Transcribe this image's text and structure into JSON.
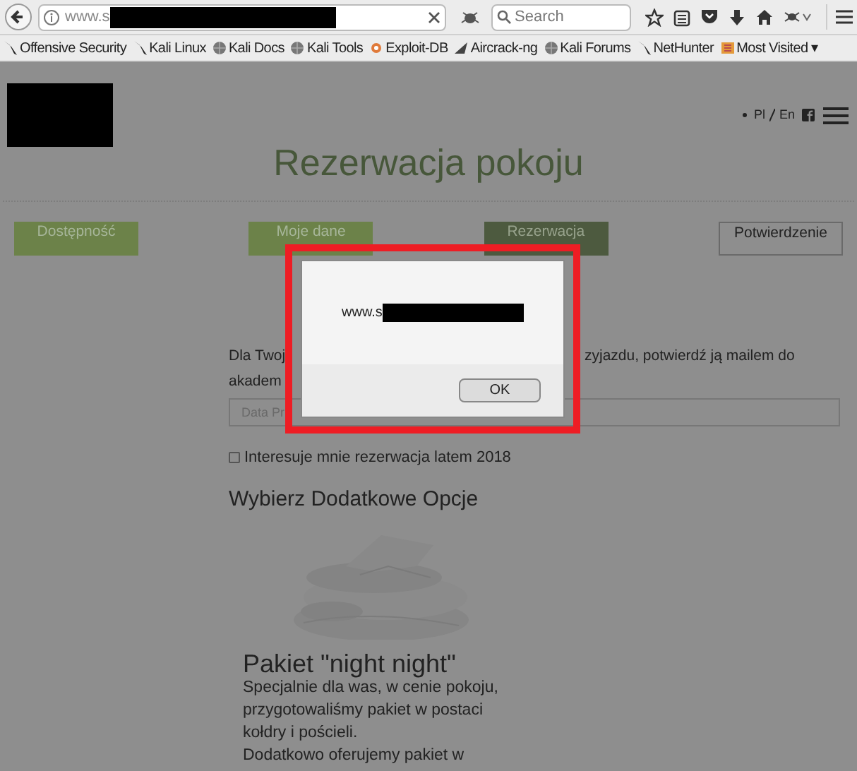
{
  "browser": {
    "url": "www.s",
    "search_placeholder": "Search",
    "bookmarks": [
      {
        "label": "Offensive Security",
        "kind": "dragon"
      },
      {
        "label": "Kali Linux",
        "kind": "dragon"
      },
      {
        "label": "Kali Docs",
        "kind": "globe"
      },
      {
        "label": "Kali Tools",
        "kind": "globe"
      },
      {
        "label": "Exploit-DB",
        "kind": "bug"
      },
      {
        "label": "Aircrack-ng",
        "kind": "wing"
      },
      {
        "label": "Kali Forums",
        "kind": "globe"
      },
      {
        "label": "NetHunter",
        "kind": "dragon"
      },
      {
        "label": "Most Visited ▾",
        "kind": "folder"
      }
    ]
  },
  "header": {
    "languages": [
      {
        "label": "Pl"
      },
      {
        "label": "En"
      }
    ]
  },
  "title": "Rezerwacja pokoju",
  "steps": [
    {
      "label": "Dostępność",
      "kind": "done"
    },
    {
      "label": "Moje dane",
      "kind": "done"
    },
    {
      "label": "Rezerwacja",
      "kind": "current"
    },
    {
      "label": "Potwierdzenie",
      "kind": "todo"
    }
  ],
  "intro": {
    "line_1_start": "Dla Twoj",
    "line_1_end": "zyjazdu, potwierdź ją mailem do",
    "line_2_start": "akadem"
  },
  "date_field": {
    "placeholder": "Data Pr"
  },
  "summer_option": {
    "label": "Interesuje mnie rezerwacja latem 2018",
    "checked": false
  },
  "options_heading": "Wybierz Dodatkowe Opcje",
  "package": {
    "kind": "picture",
    "title": "Pakiet \"night night\"",
    "lines": [
      "Specjalnie dla was, w cenie pokoju,",
      "przygotowaliśmy pakiet w postaci",
      "kołdry i pościeli.",
      "Dodatkowo oferujemy pakiet w"
    ]
  },
  "alert": {
    "message": "www.s",
    "button": "OK"
  }
}
